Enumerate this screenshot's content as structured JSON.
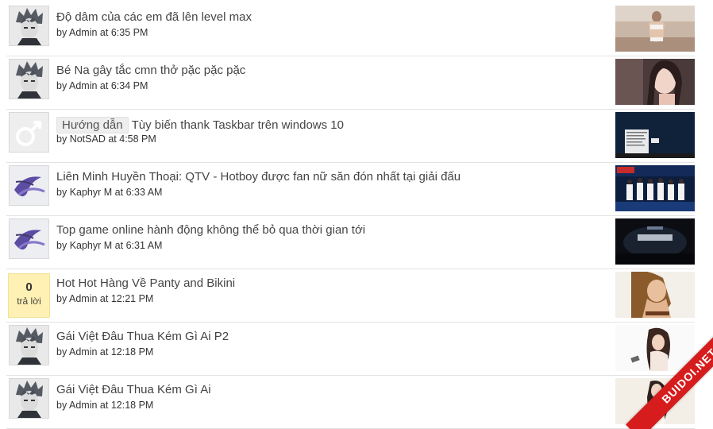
{
  "posts": [
    {
      "title": "Độ dâm của các em đã lên level max",
      "label": "",
      "by": "by",
      "author": "Admin",
      "at": "at",
      "time": "6:35 PM",
      "avatar": "anime-boy-icon"
    },
    {
      "title": "Bé Na gây tắc cmn thở pặc pặc pặc",
      "label": "",
      "by": "by",
      "author": "Admin",
      "at": "at",
      "time": "6:34 PM",
      "avatar": "anime-boy-icon"
    },
    {
      "title": "Tùy biến thank Taskbar trên windows 10",
      "label": "Hướng dẫn",
      "by": "by",
      "author": "NotSAD",
      "at": "at",
      "time": "4:58 PM",
      "avatar": "male-symbol-icon"
    },
    {
      "title": "Liên Minh Huyền Thoại: QTV - Hotboy được fan nữ săn đón nhất tại giải đấu",
      "label": "",
      "by": "by",
      "author": "Kaphyr M",
      "at": "at",
      "time": "6:33 AM",
      "avatar": "purple-swirl-icon"
    },
    {
      "title": "Top game online hành động không thể bỏ qua thời gian tới",
      "label": "",
      "by": "by",
      "author": "Kaphyr M",
      "at": "at",
      "time": "6:31 AM",
      "avatar": "purple-swirl-icon"
    },
    {
      "title": "Hot Hot Hàng Về Panty and Bikini",
      "label": "",
      "by": "by",
      "author": "Admin",
      "at": "at",
      "time": "12:21 PM",
      "reply_count": "0",
      "reply_label": "trả lời"
    },
    {
      "title": "Gái Việt Đâu Thua Kém Gì Ai P2",
      "label": "",
      "by": "by",
      "author": "Admin",
      "at": "at",
      "time": "12:18 PM",
      "avatar": "anime-boy-icon"
    },
    {
      "title": "Gái Việt Đâu Thua Kém Gì Ai",
      "label": "",
      "by": "by",
      "author": "Admin",
      "at": "at",
      "time": "12:18 PM",
      "avatar": "anime-boy-icon"
    }
  ],
  "watermark": "BUIDOI.NET",
  "colors": {
    "ribbon": "#d61c1c",
    "reply_bg": "#fff1b3",
    "divider": "#e3e3e3"
  }
}
